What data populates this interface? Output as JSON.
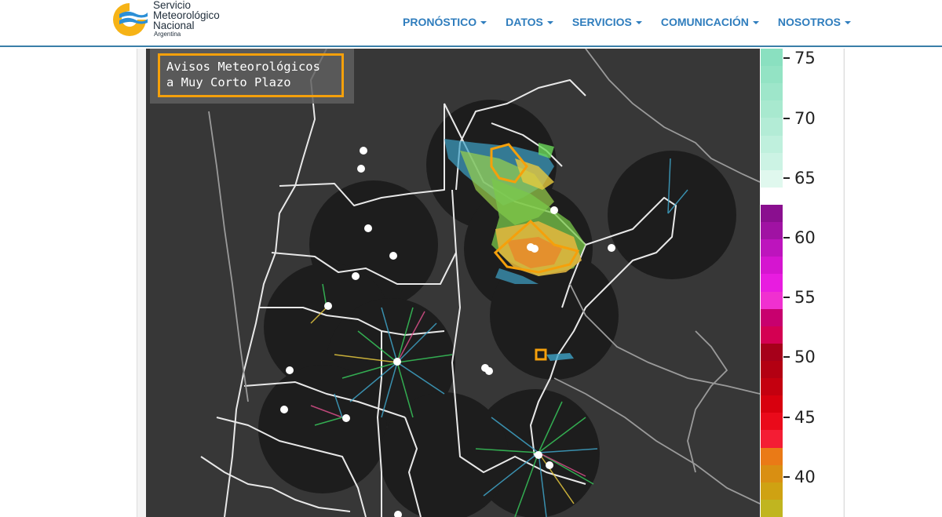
{
  "header": {
    "logo": {
      "line1": "Servicio",
      "line2": "Meteorológico",
      "line3": "Nacional",
      "line4": "Argentina"
    },
    "nav": [
      {
        "label": "PRONÓSTICO",
        "icon": "caret-down-icon"
      },
      {
        "label": "DATOS",
        "icon": "caret-down-icon"
      },
      {
        "label": "SERVICIOS",
        "icon": "caret-down-icon"
      },
      {
        "label": "COMUNICACIÓN",
        "icon": "caret-down-icon"
      },
      {
        "label": "NOSOTROS",
        "icon": "caret-down-icon"
      }
    ]
  },
  "map": {
    "legend_line1": "Avisos Meteorológicos",
    "legend_line2": "a Muy Corto Plazo",
    "alert_color": "#f5a00b",
    "background_color": "#373737"
  },
  "colorbar": {
    "ticks": [
      "75",
      "70",
      "65",
      "60",
      "55",
      "50",
      "45",
      "40"
    ],
    "colors_top_to_bottom": [
      "#8ae0c0",
      "#93e3c4",
      "#9ee6ca",
      "#a8e9cf",
      "#b3ecd6",
      "#bff0dd",
      "#ccf3e4",
      "#e0f8ee",
      "#ffffff",
      "#8a0f8f",
      "#a012a3",
      "#bd14bd",
      "#d515d0",
      "#e81ce0",
      "#f030d0",
      "#c8006e",
      "#d40052",
      "#a6001a",
      "#b30012",
      "#c4000f",
      "#d8000e",
      "#ea0a1a",
      "#f41d34",
      "#ea7a16",
      "#d98f12",
      "#cfa212",
      "#c0b520"
    ]
  }
}
